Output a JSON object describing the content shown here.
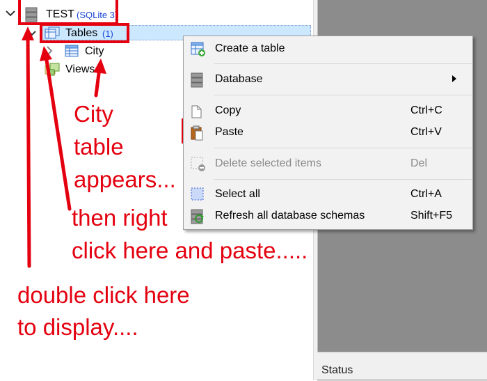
{
  "tree": {
    "db_name": "TEST",
    "db_engine": "(SQLite 3)",
    "tables_label": "Tables",
    "tables_count": "(1)",
    "city_label": "City",
    "views_label": "Views"
  },
  "context_menu": {
    "items": [
      {
        "label": "Create a table",
        "shortcut": ""
      },
      {
        "label": "Database",
        "shortcut": ""
      },
      {
        "label": "Copy",
        "shortcut": "Ctrl+C"
      },
      {
        "label": "Paste",
        "shortcut": "Ctrl+V"
      },
      {
        "label": "Delete selected items",
        "shortcut": "Del"
      },
      {
        "label": "Select all",
        "shortcut": "Ctrl+A"
      },
      {
        "label": "Refresh all database schemas",
        "shortcut": "Shift+F5"
      }
    ]
  },
  "status_bar": {
    "label": "Status"
  },
  "annotations": {
    "city_line1": "City",
    "city_line2": "table",
    "city_line3": "appears...",
    "right_click_line1": "then right",
    "right_click_line2": "click here and paste.....",
    "double_click_line1": "double click here",
    "double_click_line2": "to display...."
  },
  "colors": {
    "annotation_red": "#e4000f",
    "selection_bg": "#cce8ff",
    "engine_text": "#1a47d8",
    "right_panel_bg": "#8c8c8c"
  }
}
